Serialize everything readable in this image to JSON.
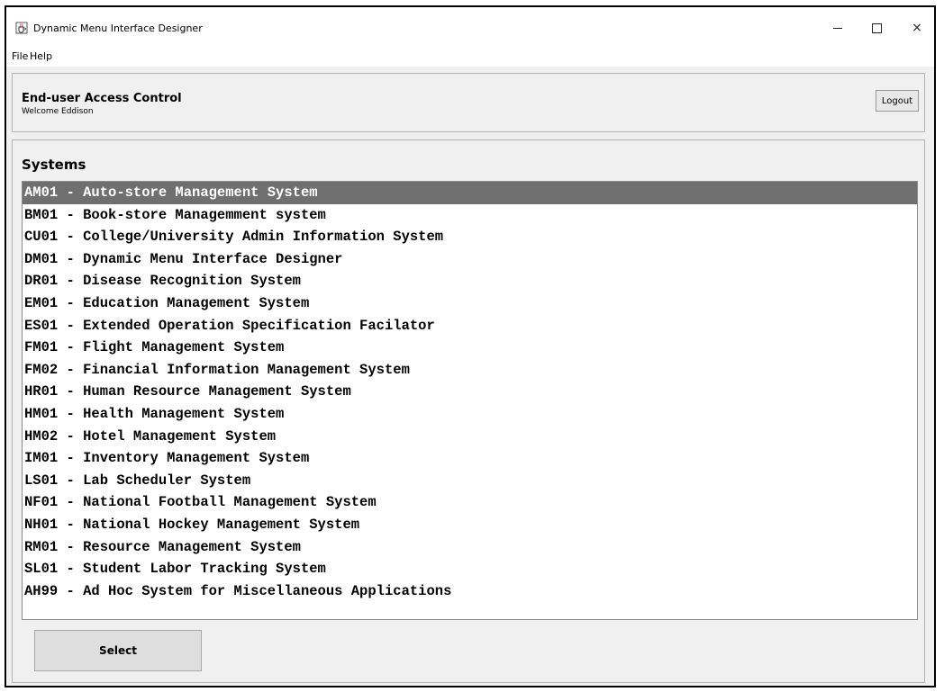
{
  "window": {
    "title": "Dynamic Menu Interface Designer",
    "icon": "java-cup-icon",
    "controls": {
      "minimize": "minimize-icon",
      "maximize": "maximize-icon",
      "close": "×"
    }
  },
  "menubar": {
    "items": [
      "File",
      "Help"
    ]
  },
  "header": {
    "title": "End-user Access Control",
    "welcome": "Welcome Eddison",
    "logout_label": "Logout"
  },
  "systems": {
    "title": "Systems",
    "selected_index": 0,
    "selected_color": "#6f6f6f",
    "items": [
      "AM01 - Auto-store Management System",
      "BM01 - Book-store Managemment system",
      "CU01 - College/University Admin Information System",
      "DM01 - Dynamic Menu Interface Designer",
      "DR01 - Disease Recognition System",
      "EM01 - Education Management System",
      "ES01 - Extended Operation Specification Facilator",
      "FM01 - Flight Management System",
      "FM02 - Financial Information Management System",
      "HR01 - Human Resource Management System",
      "HM01 - Health Management System",
      "HM02 - Hotel Management System",
      "IM01 - Inventory Management System",
      "LS01 - Lab Scheduler System",
      "NF01 - National Football Management System",
      "NH01 - National Hockey Management System",
      "RM01 - Resource Management System",
      "SL01 - Student Labor Tracking System",
      "AH99 - Ad Hoc System for Miscellaneous Applications"
    ]
  },
  "actions": {
    "select_label": "Select"
  }
}
